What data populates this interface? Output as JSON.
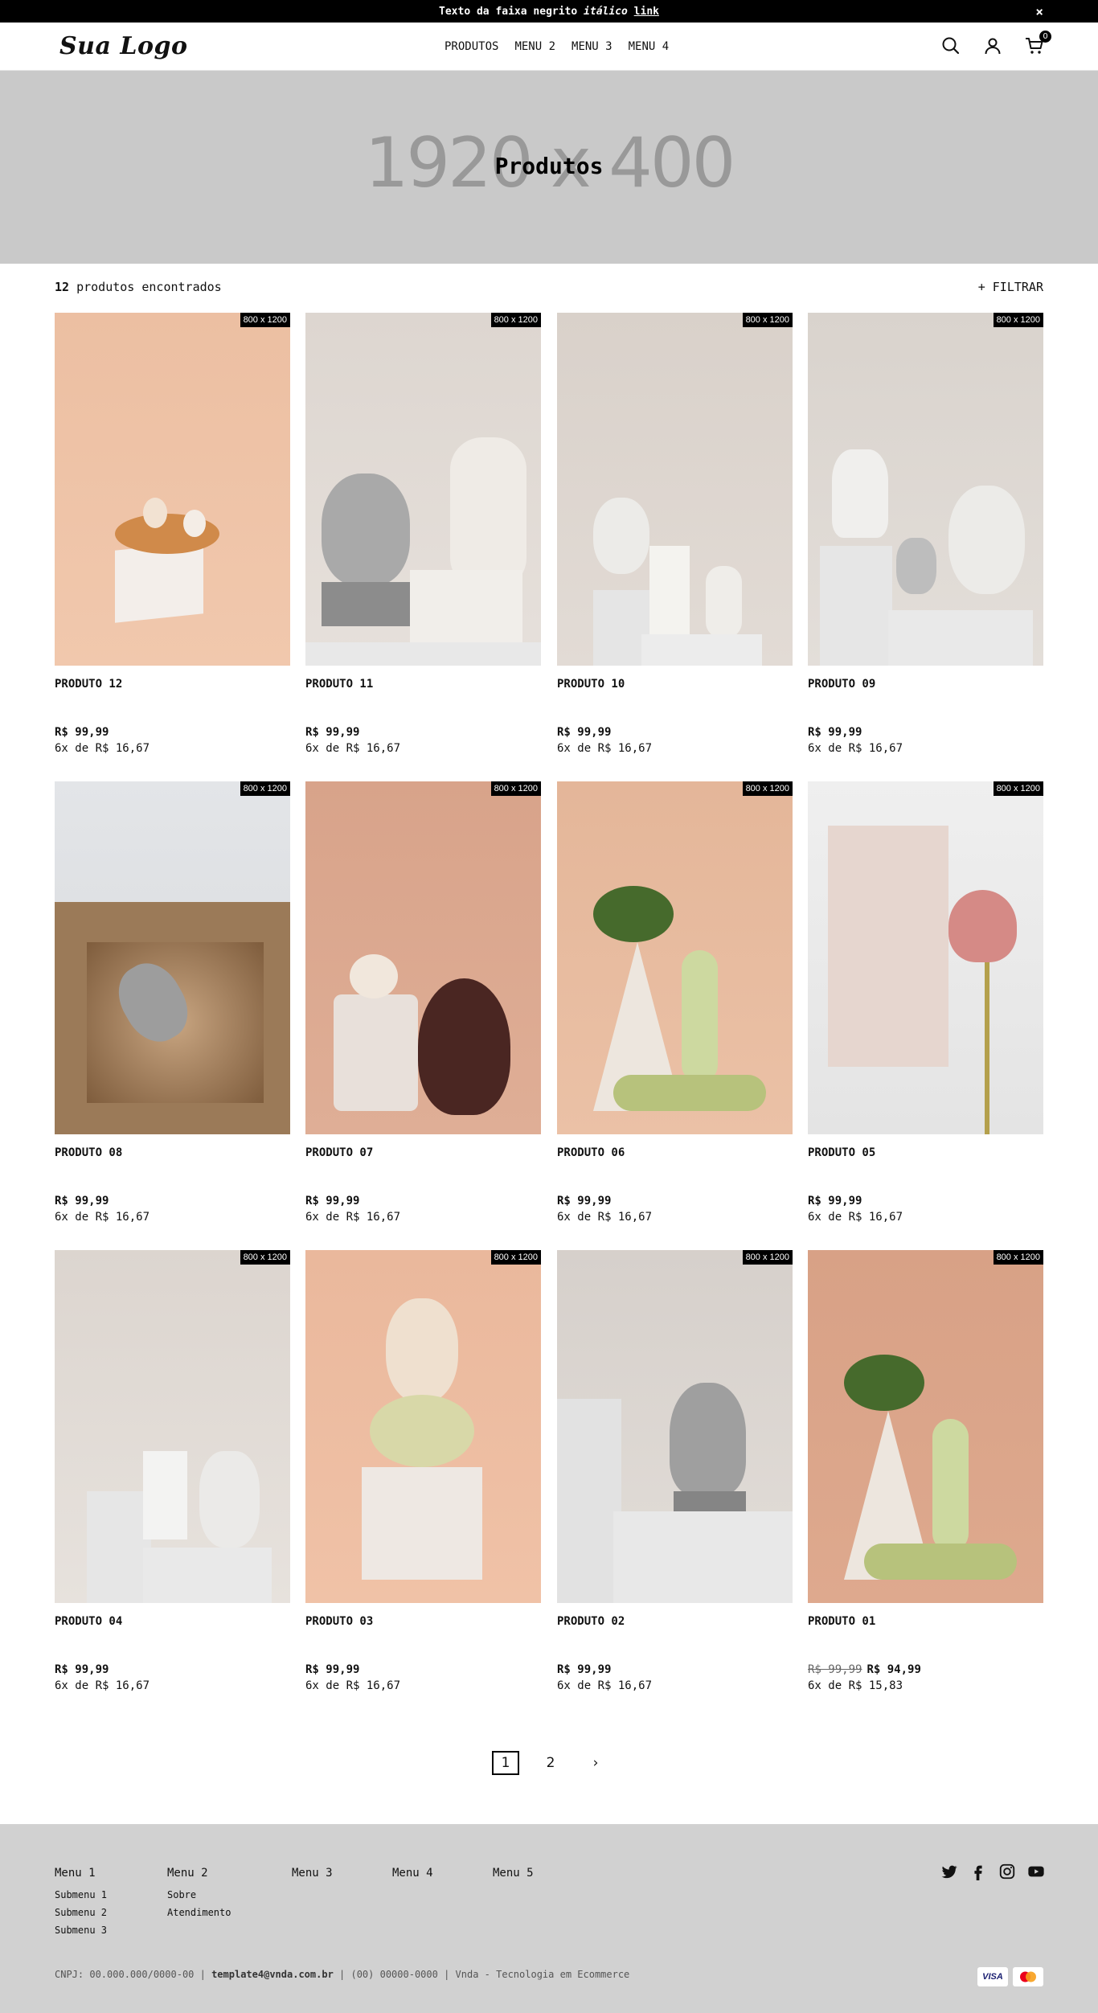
{
  "announcement": {
    "text_before": "Texto da faixa ",
    "bold": "negrito",
    "italic": "itálico",
    "link": "link",
    "close": "×"
  },
  "header": {
    "logo": "Sua Logo",
    "nav": [
      "PRODUTOS",
      "MENU 2",
      "MENU 3",
      "MENU 4"
    ],
    "cart_count": "0",
    "icons": [
      "search-icon",
      "user-icon",
      "cart-icon"
    ]
  },
  "banner": {
    "placeholder": "1920 x 400",
    "title": "Produtos"
  },
  "toolbar": {
    "count": "12",
    "count_label": " produtos encontrados",
    "filter": "+ FILTRAR"
  },
  "products": [
    {
      "name": "PRODUTO 12",
      "price": "R$ 99,99",
      "old_price": "",
      "installments": "6x de R$ 16,67",
      "badge": "800 x 1200"
    },
    {
      "name": "PRODUTO 11",
      "price": "R$ 99,99",
      "old_price": "",
      "installments": "6x de R$ 16,67",
      "badge": "800 x 1200"
    },
    {
      "name": "PRODUTO 10",
      "price": "R$ 99,99",
      "old_price": "",
      "installments": "6x de R$ 16,67",
      "badge": "800 x 1200"
    },
    {
      "name": "PRODUTO 09",
      "price": "R$ 99,99",
      "old_price": "",
      "installments": "6x de R$ 16,67",
      "badge": "800 x 1200"
    },
    {
      "name": "PRODUTO 08",
      "price": "R$ 99,99",
      "old_price": "",
      "installments": "6x de R$ 16,67",
      "badge": "800 x 1200"
    },
    {
      "name": "PRODUTO 07",
      "price": "R$ 99,99",
      "old_price": "",
      "installments": "6x de R$ 16,67",
      "badge": "800 x 1200"
    },
    {
      "name": "PRODUTO 06",
      "price": "R$ 99,99",
      "old_price": "",
      "installments": "6x de R$ 16,67",
      "badge": "800 x 1200"
    },
    {
      "name": "PRODUTO 05",
      "price": "R$ 99,99",
      "old_price": "",
      "installments": "6x de R$ 16,67",
      "badge": "800 x 1200"
    },
    {
      "name": "PRODUTO 04",
      "price": "R$ 99,99",
      "old_price": "",
      "installments": "6x de R$ 16,67",
      "badge": "800 x 1200"
    },
    {
      "name": "PRODUTO 03",
      "price": "R$ 99,99",
      "old_price": "",
      "installments": "6x de R$ 16,67",
      "badge": "800 x 1200"
    },
    {
      "name": "PRODUTO 02",
      "price": "R$ 99,99",
      "old_price": "",
      "installments": "6x de R$ 16,67",
      "badge": "800 x 1200"
    },
    {
      "name": "PRODUTO 01",
      "price": "R$ 94,99",
      "old_price": "R$ 99,99",
      "installments": "6x de R$ 15,83",
      "badge": "800 x 1200"
    }
  ],
  "pagination": {
    "pages": [
      "1",
      "2"
    ],
    "current": "1",
    "next": "›"
  },
  "footer": {
    "menus": [
      {
        "title": "Menu 1",
        "items": [
          "Submenu 1",
          "Submenu 2",
          "Submenu 3"
        ]
      },
      {
        "title": "Menu 2",
        "items": [
          "Sobre",
          "Atendimento"
        ]
      },
      {
        "title": "Menu 3",
        "items": []
      },
      {
        "title": "Menu 4",
        "items": []
      },
      {
        "title": "Menu 5",
        "items": []
      }
    ],
    "social": [
      "twitter-icon",
      "facebook-icon",
      "instagram-icon",
      "youtube-icon"
    ],
    "legal": {
      "cnpj": "CNPJ: 00.000.000/0000-00",
      "email": "template4@vnda.com.br",
      "phone": "(00) 00000-0000",
      "credit": "Vnda - Tecnologia em Ecommerce",
      "sep": " | "
    },
    "payments": [
      "VISA",
      "mastercard"
    ]
  },
  "colors": {
    "topbar": "#000000",
    "banner": "#c9c9c9",
    "footer": "#d1d1d1",
    "accent": "#000000"
  }
}
